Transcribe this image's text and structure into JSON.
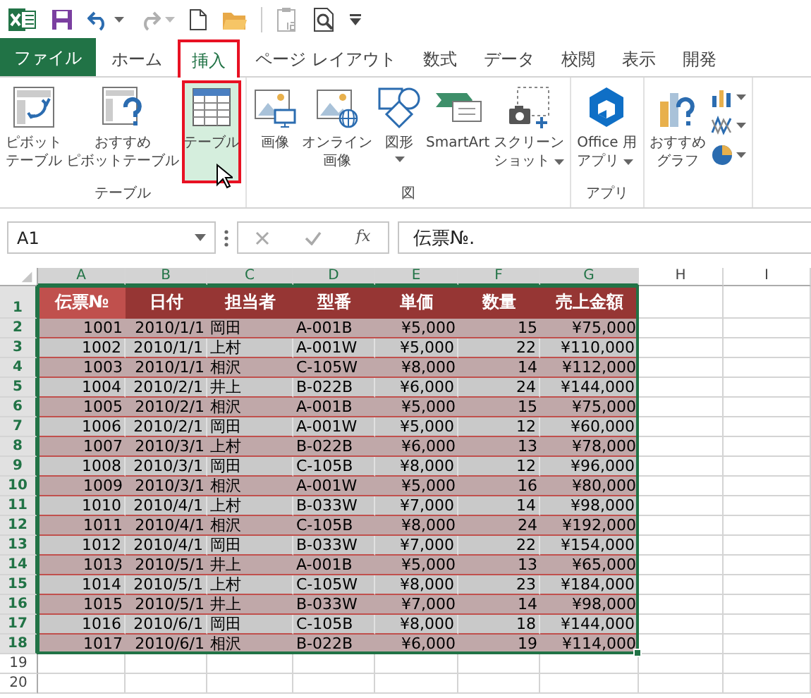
{
  "quick_access": [
    {
      "kind": "app-logo"
    },
    {
      "kind": "save"
    },
    {
      "kind": "undo",
      "dropdown": true,
      "disabled": false
    },
    {
      "kind": "redo",
      "dropdown": true,
      "disabled": true
    },
    {
      "kind": "new"
    },
    {
      "kind": "open"
    },
    {
      "kind": "separator"
    },
    {
      "kind": "clipboard",
      "disabled": true
    },
    {
      "kind": "print-preview"
    },
    {
      "kind": "customize"
    }
  ],
  "tabs": [
    {
      "label": "ファイル",
      "kind": "file",
      "selected": false
    },
    {
      "label": "ホーム",
      "kind": "tab",
      "selected": false
    },
    {
      "label": "挿入",
      "kind": "tab",
      "selected": true
    },
    {
      "label": "ページ レイアウト",
      "kind": "tab",
      "selected": false
    },
    {
      "label": "数式",
      "kind": "tab",
      "selected": false
    },
    {
      "label": "データ",
      "kind": "tab",
      "selected": false
    },
    {
      "label": "校閲",
      "kind": "tab",
      "selected": false
    },
    {
      "label": "表示",
      "kind": "tab",
      "selected": false
    },
    {
      "label": "開発",
      "kind": "tab",
      "selected": false
    }
  ],
  "ribbon_groups": [
    {
      "label": "テーブル",
      "items": [
        {
          "kind": "pivot-table",
          "lines": [
            "ピボット",
            "テーブル"
          ],
          "dropdown": false,
          "highlighted": false
        },
        {
          "kind": "recommended-pivot",
          "lines": [
            "おすすめ",
            "ピボットテーブル"
          ],
          "dropdown": false,
          "highlighted": false
        },
        {
          "kind": "table",
          "lines": [
            "テーブル"
          ],
          "dropdown": false,
          "highlighted": true
        }
      ]
    },
    {
      "label": "図",
      "items": [
        {
          "kind": "picture",
          "lines": [
            "画像"
          ],
          "dropdown": false,
          "highlighted": false
        },
        {
          "kind": "online-picture",
          "lines": [
            "オンライン",
            "画像"
          ],
          "dropdown": false,
          "highlighted": false
        },
        {
          "kind": "shapes",
          "lines": [
            "図形"
          ],
          "dropdown": true,
          "highlighted": false
        },
        {
          "kind": "smartart",
          "lines": [
            "SmartArt"
          ],
          "dropdown": false,
          "highlighted": false
        },
        {
          "kind": "screenshot",
          "lines": [
            "スクリーン",
            "ショット"
          ],
          "dropdown": true,
          "highlighted": false
        }
      ]
    },
    {
      "label": "アプリ",
      "items": [
        {
          "kind": "office-apps",
          "lines": [
            "Office 用",
            "アプリ"
          ],
          "dropdown": true,
          "highlighted": false
        }
      ]
    },
    {
      "items": [
        {
          "kind": "recommended-chart",
          "lines": [
            "おすすめ",
            "グラフ"
          ],
          "dropdown": false,
          "highlighted": false
        },
        {
          "kind": "column-chart-small",
          "dropdown": true
        },
        {
          "kind": "line-chart-small",
          "dropdown": true
        },
        {
          "kind": "pie-chart-small",
          "dropdown": true
        }
      ]
    }
  ],
  "formula_bar": {
    "name_box": "A1",
    "function_button": "fx",
    "formula": "伝票№."
  },
  "sheet": {
    "columns": [
      {
        "letter": "A",
        "selected": true
      },
      {
        "letter": "B",
        "selected": true
      },
      {
        "letter": "C",
        "selected": true
      },
      {
        "letter": "D",
        "selected": true
      },
      {
        "letter": "E",
        "selected": true
      },
      {
        "letter": "F",
        "selected": true
      },
      {
        "letter": "G",
        "selected": true
      },
      {
        "letter": "H",
        "selected": false
      },
      {
        "letter": "I",
        "selected": false
      }
    ],
    "row_numbers": [
      {
        "number": "1",
        "selected": true
      },
      {
        "number": "2",
        "selected": true
      },
      {
        "number": "3",
        "selected": true
      },
      {
        "number": "4",
        "selected": true
      },
      {
        "number": "5",
        "selected": true
      },
      {
        "number": "6",
        "selected": true
      },
      {
        "number": "7",
        "selected": true
      },
      {
        "number": "8",
        "selected": true
      },
      {
        "number": "9",
        "selected": true
      },
      {
        "number": "10",
        "selected": true
      },
      {
        "number": "11",
        "selected": true
      },
      {
        "number": "12",
        "selected": true
      },
      {
        "number": "13",
        "selected": true
      },
      {
        "number": "14",
        "selected": true
      },
      {
        "number": "15",
        "selected": true
      },
      {
        "number": "16",
        "selected": true
      },
      {
        "number": "17",
        "selected": true
      },
      {
        "number": "18",
        "selected": true
      },
      {
        "number": "19",
        "selected": false
      },
      {
        "number": "20",
        "selected": false
      }
    ],
    "table_header": [
      "伝票№",
      "日付",
      "担当者",
      "型番",
      "単価",
      "数量",
      "売上金額"
    ],
    "rows": [
      [
        "1001",
        "2010/1/1",
        "岡田",
        "A-001B",
        "¥5,000",
        "15",
        "¥75,000"
      ],
      [
        "1002",
        "2010/1/1",
        "上村",
        "A-001W",
        "¥5,000",
        "22",
        "¥110,000"
      ],
      [
        "1003",
        "2010/1/1",
        "相沢",
        "C-105W",
        "¥8,000",
        "14",
        "¥112,000"
      ],
      [
        "1004",
        "2010/2/1",
        "井上",
        "B-022B",
        "¥6,000",
        "24",
        "¥144,000"
      ],
      [
        "1005",
        "2010/2/1",
        "相沢",
        "A-001B",
        "¥5,000",
        "15",
        "¥75,000"
      ],
      [
        "1006",
        "2010/2/1",
        "岡田",
        "A-001W",
        "¥5,000",
        "12",
        "¥60,000"
      ],
      [
        "1007",
        "2010/3/1",
        "上村",
        "B-022B",
        "¥6,000",
        "13",
        "¥78,000"
      ],
      [
        "1008",
        "2010/3/1",
        "岡田",
        "C-105B",
        "¥8,000",
        "12",
        "¥96,000"
      ],
      [
        "1009",
        "2010/3/1",
        "相沢",
        "A-001W",
        "¥5,000",
        "16",
        "¥80,000"
      ],
      [
        "1010",
        "2010/4/1",
        "上村",
        "B-033W",
        "¥7,000",
        "14",
        "¥98,000"
      ],
      [
        "1011",
        "2010/4/1",
        "相沢",
        "C-105B",
        "¥8,000",
        "24",
        "¥192,000"
      ],
      [
        "1012",
        "2010/4/1",
        "岡田",
        "B-033W",
        "¥7,000",
        "22",
        "¥154,000"
      ],
      [
        "1013",
        "2010/5/1",
        "井上",
        "A-001B",
        "¥5,000",
        "13",
        "¥65,000"
      ],
      [
        "1014",
        "2010/5/1",
        "上村",
        "C-105W",
        "¥8,000",
        "23",
        "¥184,000"
      ],
      [
        "1015",
        "2010/5/1",
        "井上",
        "B-033W",
        "¥7,000",
        "14",
        "¥98,000"
      ],
      [
        "1016",
        "2010/6/1",
        "岡田",
        "C-105B",
        "¥8,000",
        "18",
        "¥144,000"
      ],
      [
        "1017",
        "2010/6/1",
        "相沢",
        "B-022B",
        "¥6,000",
        "19",
        "¥114,000"
      ]
    ]
  }
}
